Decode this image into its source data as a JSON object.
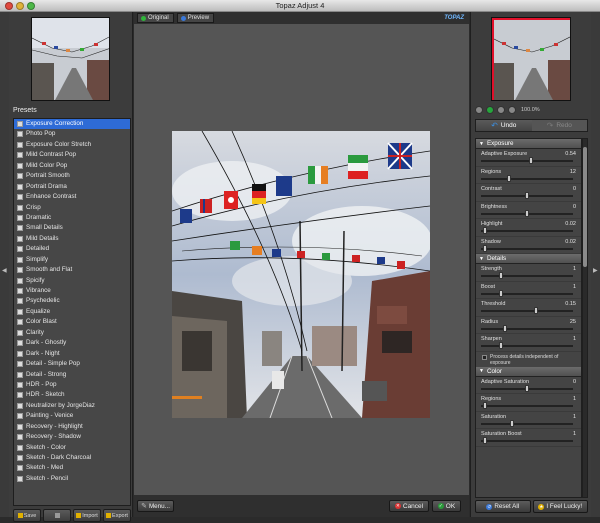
{
  "window": {
    "title": "Topaz Adjust 4"
  },
  "left": {
    "presets_label": "Presets",
    "presets": [
      "Exposure Correction",
      "Photo Pop",
      "Exposure Color Stretch",
      "Mild Contrast Pop",
      "Mild Color Pop",
      "Portrait Smooth",
      "Portrait Drama",
      "Enhance Contrast",
      "Crisp",
      "Dramatic",
      "Small Details",
      "Mild Details",
      "Detailed",
      "Simplify",
      "Smooth and Flat",
      "Spicify",
      "Vibrance",
      "Psychedelic",
      "Equalize",
      "Color Blast",
      "Clarity",
      "Dark - Ghostly",
      "Dark - Night",
      "Detail - Simple Pop",
      "Detail - Strong",
      "HDR - Pop",
      "HDR - Sketch",
      "Neutralizer by JorgeDiaz",
      "Painting - Venice",
      "Recovery - Highlight",
      "Recovery - Shadow",
      "Sketch - Color",
      "Sketch - Dark Charcoal",
      "Sketch - Med",
      "Sketch - Pencil"
    ],
    "selected_index": 0,
    "buttons": {
      "save": "Save",
      "import": "Import",
      "export": "Export"
    }
  },
  "center": {
    "tabs": {
      "original": "Original",
      "preview": "Preview"
    },
    "logo": "TOPAZ",
    "menu": "Menu...",
    "cancel": "Cancel",
    "ok": "OK"
  },
  "right": {
    "zoom": "100.0%",
    "undo": "Undo",
    "redo": "Redo",
    "exposure": {
      "title": "Exposure",
      "params": [
        {
          "label": "Adaptive Exposure",
          "value": "0.54",
          "pos": 0.54
        },
        {
          "label": "Regions",
          "value": "12",
          "pos": 0.3
        },
        {
          "label": "Contrast",
          "value": "0",
          "pos": 0.5
        },
        {
          "label": "Brightness",
          "value": "0",
          "pos": 0.5
        },
        {
          "label": "Highlight",
          "value": "0.02",
          "pos": 0.02
        },
        {
          "label": "Shadow",
          "value": "0.02",
          "pos": 0.02
        }
      ]
    },
    "details": {
      "title": "Details",
      "params": [
        {
          "label": "Strength",
          "value": "1",
          "pos": 0.2
        },
        {
          "label": "Boost",
          "value": "1",
          "pos": 0.2
        },
        {
          "label": "Threshold",
          "value": "0.15",
          "pos": 0.6
        },
        {
          "label": "Radius",
          "value": "25",
          "pos": 0.25
        },
        {
          "label": "Sharpen",
          "value": "1",
          "pos": 0.2
        }
      ],
      "checkbox": "Process details independent of exposure"
    },
    "color": {
      "title": "Color",
      "params": [
        {
          "label": "Adaptive Saturation",
          "value": "0",
          "pos": 0.5
        },
        {
          "label": "Regions",
          "value": "1",
          "pos": 0.02
        },
        {
          "label": "Saturation",
          "value": "1",
          "pos": 0.33
        },
        {
          "label": "Saturation Boost",
          "value": "1",
          "pos": 0.02
        }
      ]
    },
    "reset_all": "Reset All",
    "lucky": "I Feel Lucky!"
  }
}
